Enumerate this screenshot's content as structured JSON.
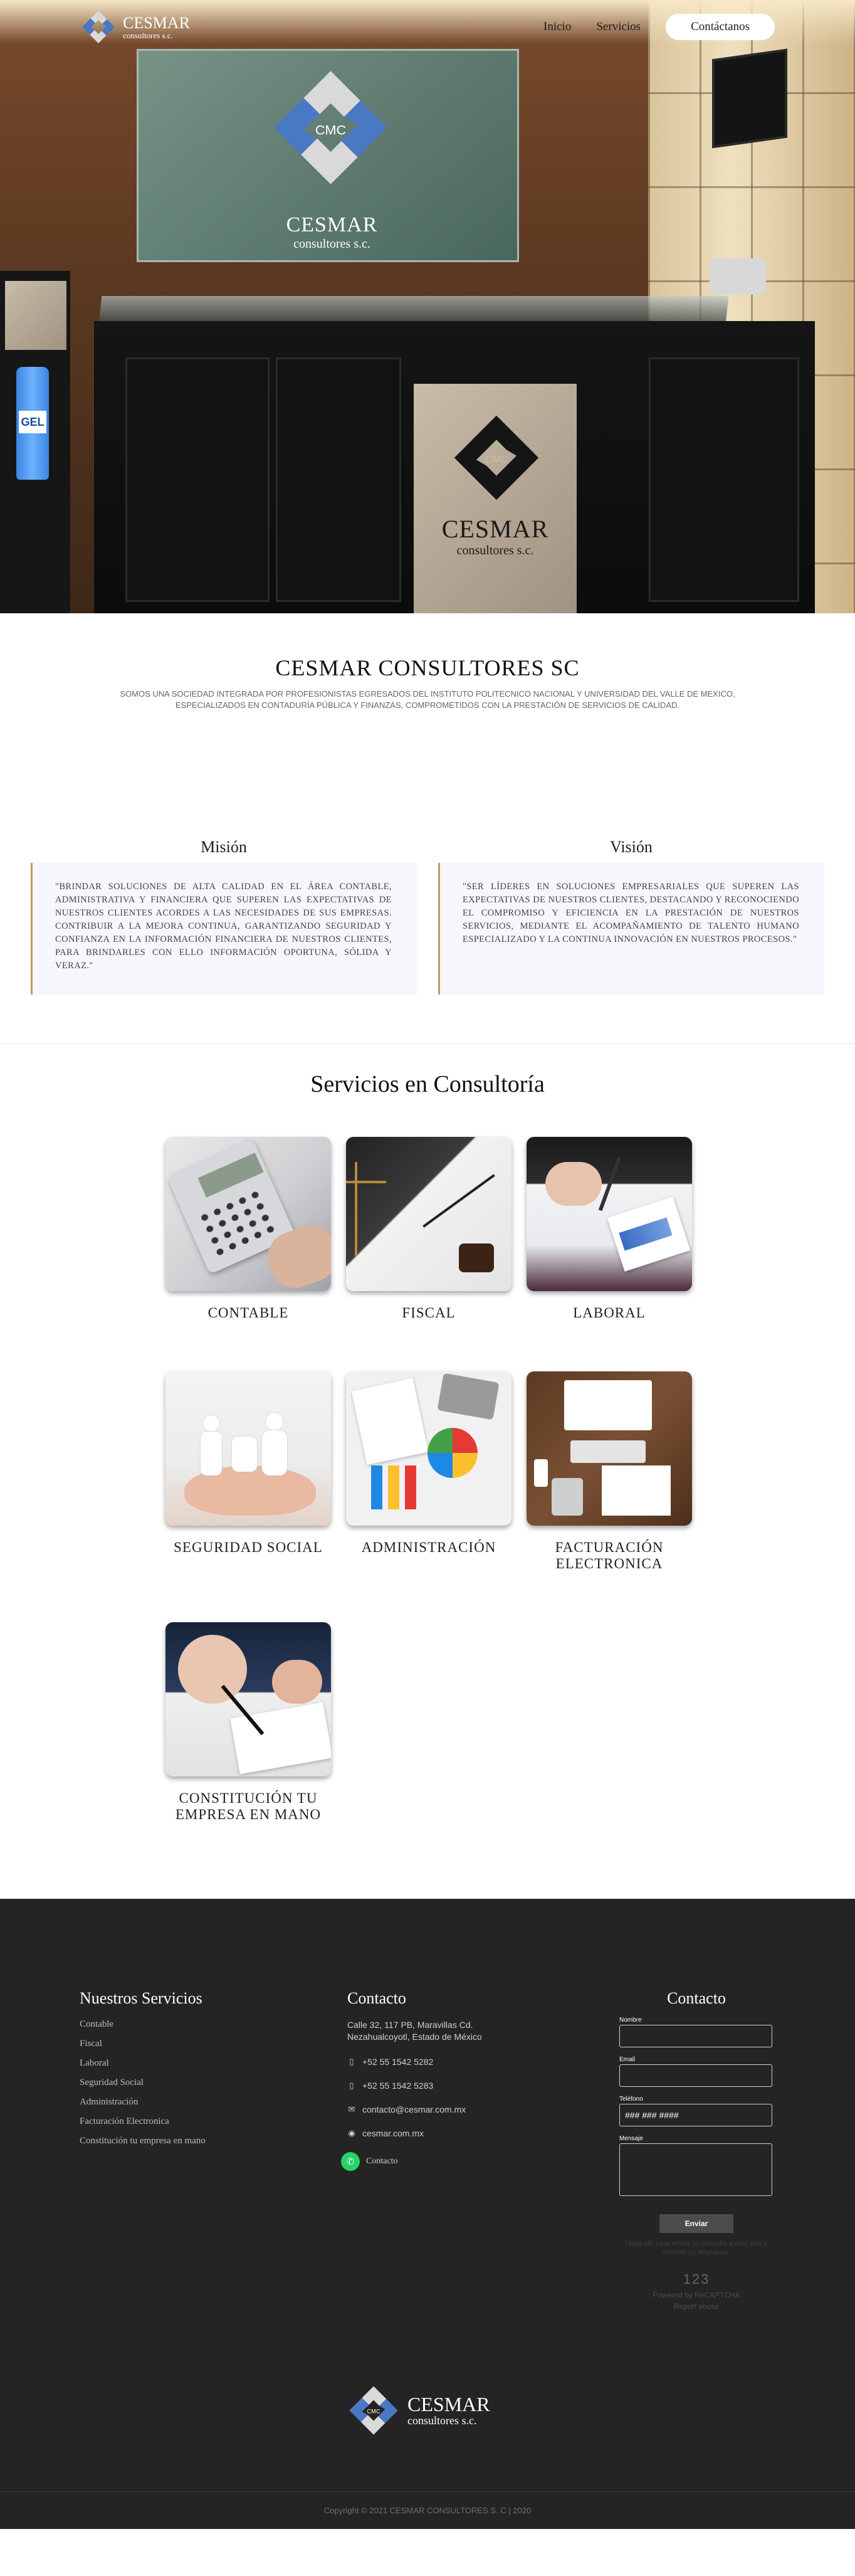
{
  "nav": {
    "logo_title": "CESMAR",
    "logo_subtitle": "consultores s.c.",
    "links": [
      "Inicio",
      "Servicios"
    ],
    "cta": "Contáctanos"
  },
  "hero": {
    "sign_cmc": "CMC",
    "sign_title": "CESMAR",
    "sign_subtitle": "consultores s.c.",
    "bottle_label": "GEL"
  },
  "about": {
    "title": "CESMAR CONSULTORES SC",
    "description": "SOMOS UNA SOCIEDAD INTEGRADA POR PROFESIONISTAS EGRESADOS DEL INSTITUTO POLITECNICO NACIONAL Y UNIVERSIDAD DEL VALLE DE MEXICO, ESPECIALIZADOS EN CONTADURÍA PÚBLICA Y FINANZAS, COMPROMETIDOS CON LA PRESTACIÓN DE SERVICIOS DE CALIDAD."
  },
  "mission": {
    "title": "Misión",
    "text": "\"BRINDAR SOLUCIONES DE ALTA CALIDAD EN EL ÁREA CONTABLE, ADMINISTRATIVA Y FINANCIERA QUE SUPEREN LAS EXPECTATIVAS DE NUESTROS CLIENTES ACORDES A LAS NECESIDADES DE SUS EMPRESAS. CONTRIBUIR A LA MEJORA CONTINUA, GARANTIZANDO SEGURIDAD Y CONFIANZA EN LA INFORMACIÓN FINANCIERA DE NUESTROS CLIENTES, PARA BRINDARLES CON ELLO INFORMACIÓN OPORTUNA, SÓLIDA Y VERAZ.\""
  },
  "vision": {
    "title": "Visión",
    "text": "\"SER LÍDERES EN SOLUCIONES EMPRESARIALES QUE SUPEREN LAS EXPECTATIVAS DE NUESTROS CLIENTES, DESTACANDO Y RECONOCIENDO EL COMPROMISO Y EFICIENCIA EN LA PRESTACIÓN DE NUESTROS SERVICIOS, MEDIANTE EL ACOMPAÑAMIENTO DE TALENTO HUMANO ESPECIALIZADO Y LA CONTINUA INNOVACIÓN EN NUESTROS PROCESOS.\""
  },
  "services": {
    "title": "Servicios en Consultoría",
    "items": [
      {
        "label": "CONTABLE",
        "icon": "calculator-photo"
      },
      {
        "label": "FISCAL",
        "icon": "law-scale-photo"
      },
      {
        "label": "LABORAL",
        "icon": "handshake-documents-photo"
      },
      {
        "label": "SEGURIDAD SOCIAL",
        "icon": "family-hands-photo"
      },
      {
        "label": "ADMINISTRACIÓN",
        "icon": "charts-desk-photo"
      },
      {
        "label": "FACTURACIÓN ELECTRONICA",
        "icon": "office-desk-photo"
      },
      {
        "label": "CONSTITUCIÓN TU EMPRESA EN MANO",
        "icon": "signing-contract-photo"
      }
    ]
  },
  "footer": {
    "services_title": "Nuestros Servicios",
    "services_links": [
      "Contable",
      "Fiscal",
      "Laboral",
      "Seguridad Social",
      "Administración",
      "Facturación Electronica",
      "Constitución tu empresa en mano"
    ],
    "contact_title": "Contacto",
    "address": "Calle 32, 117 PB, Maravillas Cd. Nezahualcoyotl, Estado de México",
    "phone1": "+52 55 1542 5282",
    "phone2": "+52 55 1542 5283",
    "email": "contacto@cesmar.com.mx",
    "web": "cesmar.com.mx",
    "whatsapp": "Contacto",
    "form_title": "Contacto",
    "form": {
      "name_label": "Nombre",
      "email_label": "Email",
      "phone_label": "Teléfono",
      "phone_placeholder": "### ### ####",
      "message_label": "Mensaje",
      "submit": "Enviar",
      "hint": "Haga clic para enviar su consulta a este sitio y obtener su respuesta.",
      "captcha_number": "123",
      "captcha_line1": "Powered by ReCAPTCHA",
      "captcha_line2": "Report abuse"
    },
    "logo_title": "CESMAR",
    "logo_subtitle": "consultores s.c.",
    "logo_cmc": "CMC",
    "copyright": "Copyright © 2021 CESMAR CONSULTORES S. C | 2020"
  },
  "colors": {
    "accent_blue": "#4a78c2",
    "footer_bg": "#242424",
    "border_accent": "#c9975f",
    "whatsapp": "#25d366"
  }
}
